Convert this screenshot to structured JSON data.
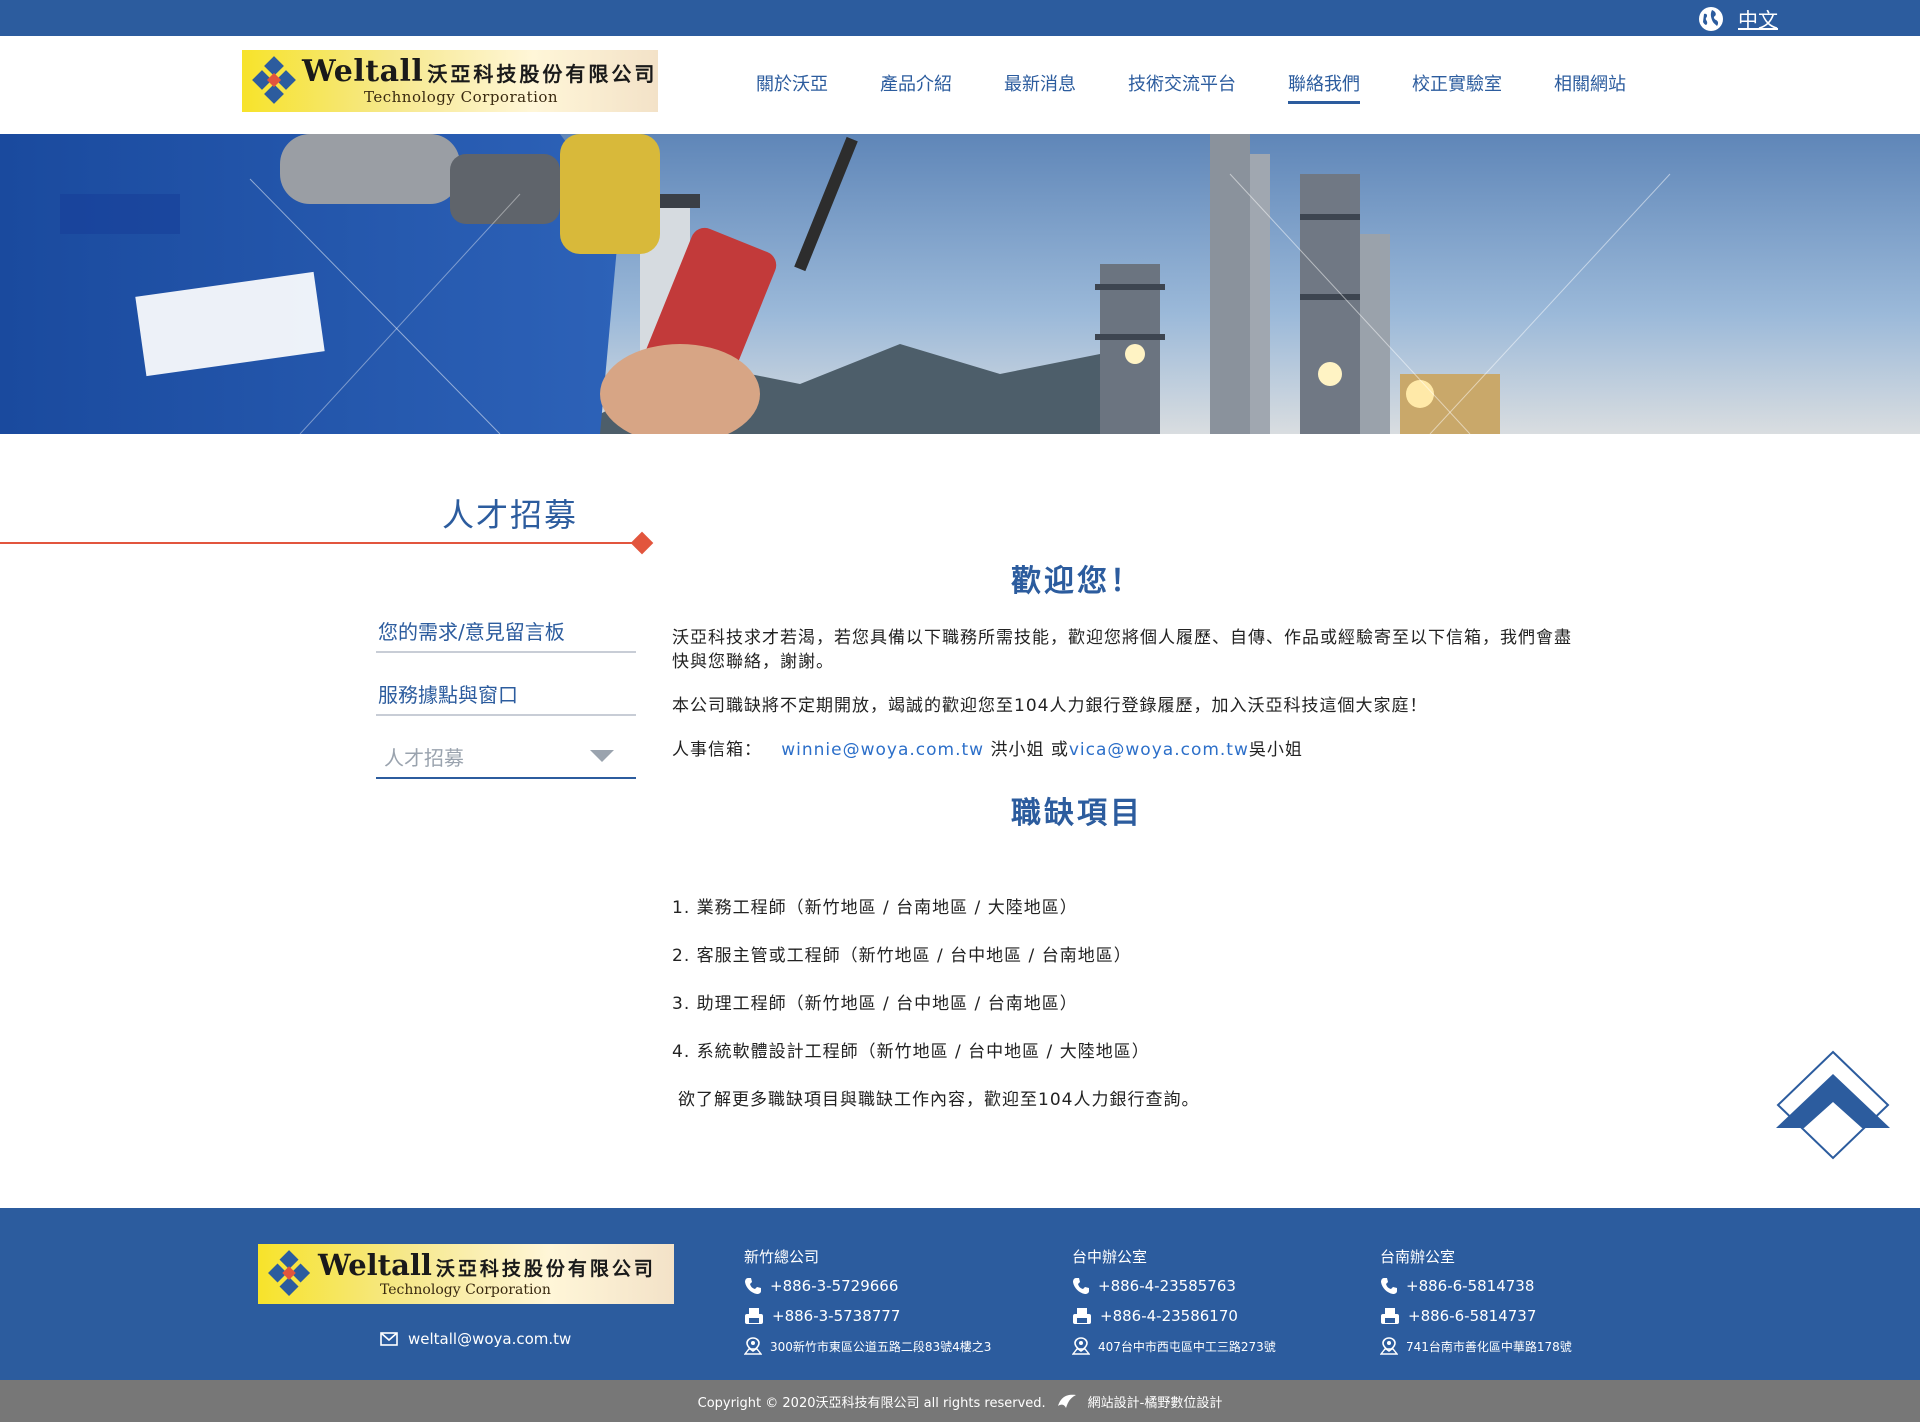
{
  "topbar": {
    "language": "中文"
  },
  "header": {
    "logo": {
      "brand_en": "Weltall",
      "brand_cn": "沃亞科技股份有限公司",
      "tagline": "Technology Corporation"
    },
    "nav": [
      "關於沃亞",
      "產品介紹",
      "最新消息",
      "技術交流平台",
      "聯絡我們",
      "校正實驗室",
      "相關網站"
    ],
    "active_nav": "聯絡我們"
  },
  "sidebar": {
    "title": "人才招募",
    "items": [
      "您的需求/意見留言板",
      "服務據點與窗口"
    ],
    "select_value": "人才招募"
  },
  "main": {
    "welcome_title": "歡迎您！",
    "intro": "沃亞科技求才若渴，若您具備以下職務所需技能，歡迎您將個人履歷、自傳、作品或經驗寄至以下信箱，我們會盡快與您聯絡，謝謝。",
    "opening_note": "本公司職缺將不定期開放，竭誠的歡迎您至104人力銀行登錄履歷，加入沃亞科技這個大家庭！",
    "hr_label": "人事信箱：",
    "hr_email_1": "winnie@woya.com.tw",
    "hr_name_1": " 洪小姐 或",
    "hr_email_2": "vica@woya.com.tw",
    "hr_name_2": "吳小姐",
    "jobs_title": "職缺項目",
    "jobs": [
      "1. 業務工程師（新竹地區 / 台南地區 / 大陸地區）",
      "2. 客服主管或工程師（新竹地區 / 台中地區 / 台南地區）",
      "3. 助理工程師（新竹地區 / 台中地區 / 台南地區）",
      "4. 系統軟體設計工程師（新竹地區 / 台中地區 / 大陸地區）"
    ],
    "more_note": "欲了解更多職缺項目與職缺工作內容，歡迎至104人力銀行查詢。"
  },
  "footer": {
    "email": "weltall@woya.com.tw",
    "offices": [
      {
        "name": "新竹總公司",
        "phone": "+886-3-5729666",
        "fax": "+886-3-5738777",
        "address": "300新竹市東區公道五路二段83號4樓之3"
      },
      {
        "name": "台中辦公室",
        "phone": "+886-4-23585763",
        "fax": "+886-4-23586170",
        "address": "407台中市西屯區中工三路273號"
      },
      {
        "name": "台南辦公室",
        "phone": "+886-6-5814738",
        "fax": "+886-6-5814737",
        "address": "741台南市善化區中華路178號"
      }
    ],
    "copyright": "Copyright © 2020沃亞科技有限公司 all rights reserved.",
    "designer": "網站設計-橘野數位設計"
  },
  "colors": {
    "brand_blue": "#2c5c9e",
    "accent_red": "#e2553d",
    "link_blue": "#2c6fc9",
    "footer_gray": "#777777"
  },
  "icons": [
    "globe-icon",
    "logo-mark-icon",
    "caret-down-icon",
    "back-to-top-icon",
    "mail-icon",
    "phone-icon",
    "fax-icon",
    "location-icon",
    "designer-logo-icon"
  ]
}
